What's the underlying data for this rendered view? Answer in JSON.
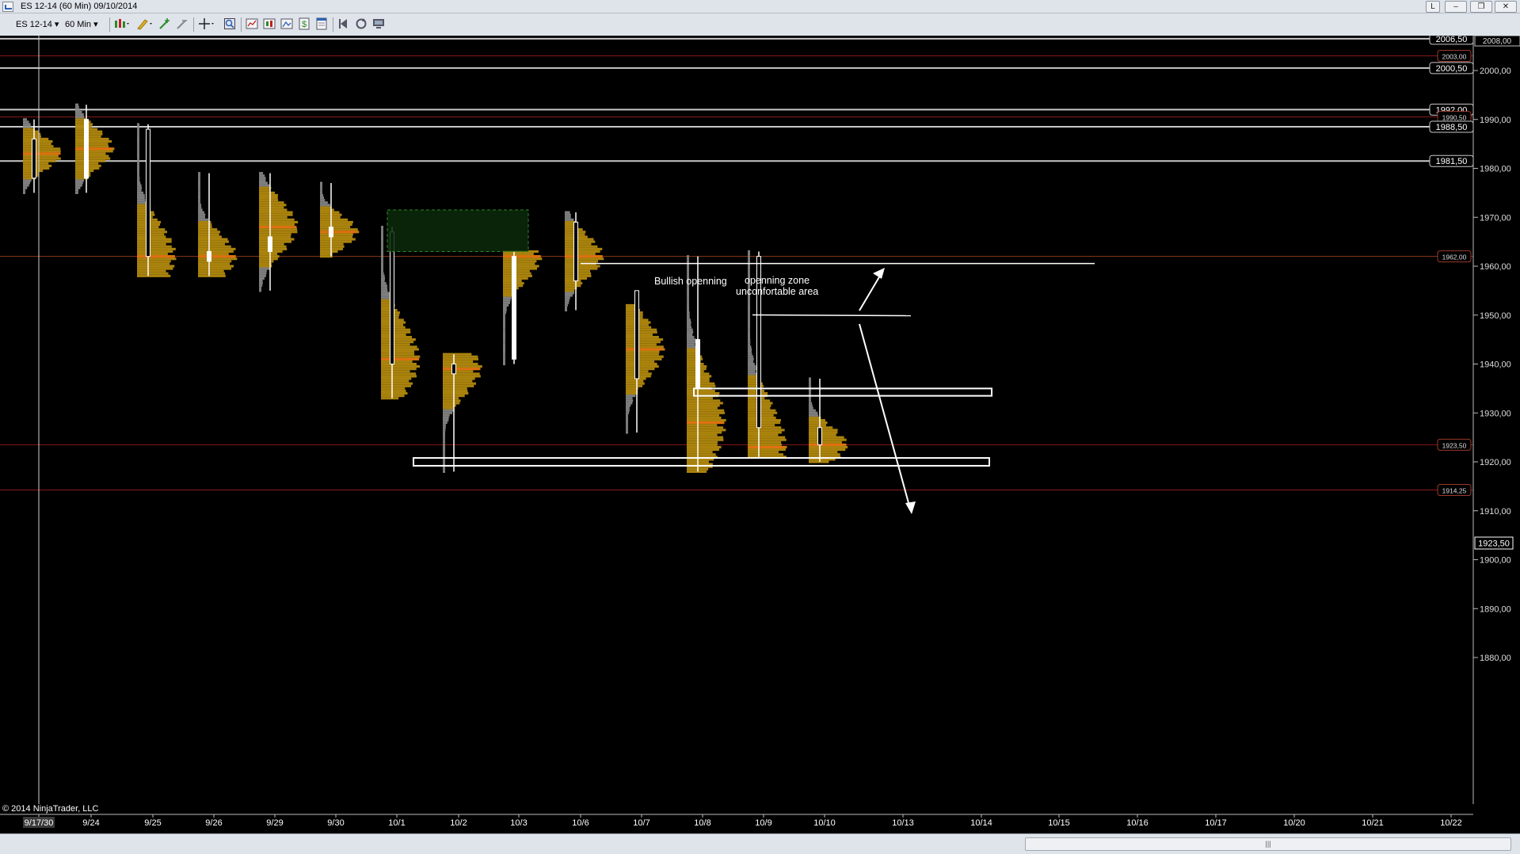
{
  "window": {
    "title": "ES 12-14 (60 Min)  09/10/2014",
    "buttons": [
      "L",
      "–",
      "❐",
      "✕"
    ]
  },
  "toolbar": {
    "instrument": "ES 12-14",
    "interval": "60 Min"
  },
  "chart_data": {
    "type": "candlestick",
    "instrument": "ES 12-14",
    "interval": "60 Min",
    "x_tick_labels": [
      "9/17/30",
      "9/24",
      "9/25",
      "9/26",
      "9/29",
      "9/30",
      "10/1",
      "10/2",
      "10/3",
      "10/6",
      "10/7",
      "10/8",
      "10/9",
      "10/10",
      "10/13",
      "10/14",
      "10/15",
      "10/16",
      "10/17",
      "10/20",
      "10/21",
      "10/22"
    ],
    "y_ticks": [
      1880,
      1890,
      1900,
      1910,
      1920,
      1930,
      1940,
      1950,
      1960,
      1970,
      1980,
      1990,
      2000
    ],
    "y_tick_labels": [
      "1880,00",
      "1890,00",
      "1900,00",
      "1910,00",
      "1920,00",
      "1930,00",
      "1940,00",
      "1950,00",
      "1960,00",
      "1970,00",
      "1980,00",
      "1990,00",
      "2000,00"
    ],
    "ylim": [
      1875,
      2008.5
    ],
    "top_price_label": "2008,00",
    "last_price": {
      "value": 1923.5,
      "label": "1923,50"
    },
    "horizontal_lines": [
      {
        "value": 2006.5,
        "label": "2006,50",
        "color": "#c8c8c8"
      },
      {
        "value": 2003.0,
        "label": "2003,00",
        "color": "#8a1a1a"
      },
      {
        "value": 2000.5,
        "label": "2000,50",
        "color": "#c8c8c8"
      },
      {
        "value": 1992.0,
        "label": "1992,00",
        "color": "#c8c8c8"
      },
      {
        "value": 1990.5,
        "label": "1990,50",
        "color": "#8a1a1a"
      },
      {
        "value": 1988.5,
        "label": "1988,50",
        "color": "#c8c8c8"
      },
      {
        "value": 1981.5,
        "label": "1981,50",
        "color": "#c8c8c8"
      },
      {
        "value": 1962.0,
        "label": "1962,00",
        "color": "#8a3a1a"
      },
      {
        "value": 1923.5,
        "label": "1923,50",
        "color": "#8a1a1a"
      },
      {
        "value": 1914.25,
        "label": "1914,25",
        "color": "#8a1a1a"
      }
    ],
    "annotations": [
      {
        "text": "Bullish openning"
      },
      {
        "text": "openning zone"
      },
      {
        "text": "unconfortable area"
      }
    ],
    "boxes": [
      {
        "from": "10/1",
        "to": "10/3",
        "low": 1963,
        "high": 1971.5,
        "style": "green-dashed"
      },
      {
        "from": "10/8",
        "to": "10/14",
        "low": 1933.5,
        "high": 1935,
        "style": "white"
      },
      {
        "from": "10/1",
        "to": "10/14",
        "low": 1919.2,
        "high": 1920.8,
        "style": "white"
      }
    ],
    "sessions": [
      {
        "date": "9/17/30",
        "open": 1986,
        "high": 1990,
        "low": 1975,
        "close": 1978,
        "poc": 1983
      },
      {
        "date": "9/24",
        "open": 1978,
        "high": 1993,
        "low": 1975,
        "close": 1990,
        "poc": 1984
      },
      {
        "date": "9/25",
        "open": 1988,
        "high": 1989,
        "low": 1958,
        "close": 1962,
        "poc": 1962
      },
      {
        "date": "9/26",
        "open": 1961,
        "high": 1979,
        "low": 1958,
        "close": 1963,
        "poc": 1962
      },
      {
        "date": "9/29",
        "open": 1963,
        "high": 1979,
        "low": 1955,
        "close": 1966,
        "poc": 1968
      },
      {
        "date": "9/30",
        "open": 1966,
        "high": 1977,
        "low": 1962,
        "close": 1968,
        "poc": 1967
      },
      {
        "date": "10/1",
        "open": 1967,
        "high": 1968,
        "low": 1933,
        "close": 1940,
        "poc": 1941
      },
      {
        "date": "10/2",
        "open": 1940,
        "high": 1942,
        "low": 1918,
        "close": 1938,
        "poc": 1939
      },
      {
        "date": "10/3",
        "open": 1941,
        "high": 1963,
        "low": 1940,
        "close": 1962,
        "poc": 1962
      },
      {
        "date": "10/6",
        "open": 1969,
        "high": 1971,
        "low": 1951,
        "close": 1957,
        "poc": 1962
      },
      {
        "date": "10/7",
        "open": 1955,
        "high": 1952,
        "low": 1926,
        "close": 1937,
        "poc": 1943
      },
      {
        "date": "10/8",
        "open": 1935,
        "high": 1962,
        "low": 1918,
        "close": 1945,
        "poc": 1928
      },
      {
        "date": "10/9",
        "open": 1962,
        "high": 1963,
        "low": 1921,
        "close": 1927,
        "poc": 1923
      },
      {
        "date": "10/10",
        "open": 1927,
        "high": 1937,
        "low": 1920,
        "close": 1923.5,
        "poc": 1923.5
      }
    ]
  },
  "footer": {
    "copyright": "© 2014 NinjaTrader, LLC"
  },
  "scrollbar": {
    "grip": "|||"
  }
}
